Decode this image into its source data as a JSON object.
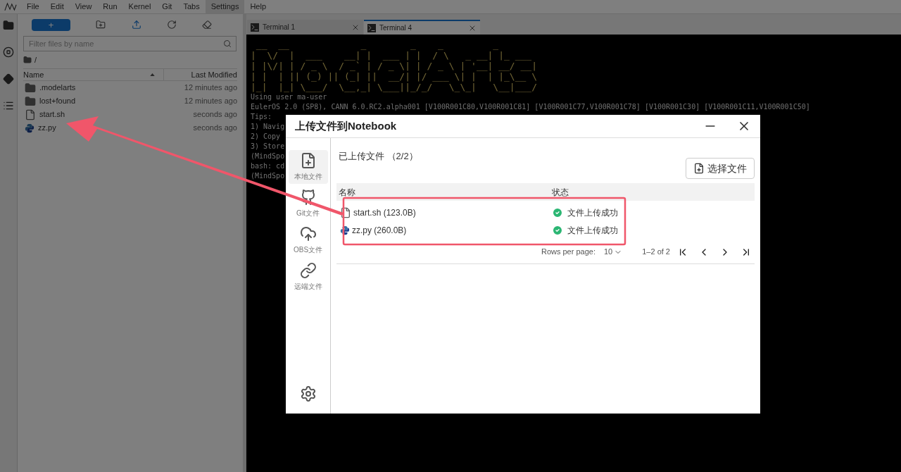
{
  "menu": [
    {
      "label": "File",
      "selected": false
    },
    {
      "label": "Edit",
      "selected": false
    },
    {
      "label": "View",
      "selected": false
    },
    {
      "label": "Run",
      "selected": false
    },
    {
      "label": "Kernel",
      "selected": false
    },
    {
      "label": "Git",
      "selected": false
    },
    {
      "label": "Tabs",
      "selected": false
    },
    {
      "label": "Settings",
      "selected": true
    },
    {
      "label": "Help",
      "selected": false
    }
  ],
  "toolbar": {
    "new_label": "+"
  },
  "file_browser": {
    "filter_placeholder": "Filter files by name",
    "path": "/",
    "columns": [
      "Name",
      "Last Modified"
    ],
    "rows": [
      {
        "name": ".modelarts",
        "modified": "12 minutes ago",
        "kind": "folder"
      },
      {
        "name": "lost+found",
        "modified": "12 minutes ago",
        "kind": "folder"
      },
      {
        "name": "start.sh",
        "modified": "seconds ago",
        "kind": "file"
      },
      {
        "name": "zz.py",
        "modified": "seconds ago",
        "kind": "python"
      }
    ]
  },
  "tabs": [
    {
      "label": "Terminal 1",
      "selected": false
    },
    {
      "label": "Terminal 4",
      "selected": true
    }
  ],
  "terminal": {
    "banner": [
      " __  __             _        _    _         _       ",
      "|  \\/  |  ___    __| |  ___ | |  / \\   _ __| |_ ___ ",
      "| |\\/| | / _ \\  / _` | / _ \\| | / _ \\ | '__| __/ __|",
      "| |  | || (_) || (_| ||  __/| |/ ___ \\| |  | |_\\__ \\",
      "|_|  |_| \\___/  \\__,_| \\___||_/_/   \\_\\_|   \\__|___/"
    ],
    "lines": [
      "Using user ma-user",
      "EulerOS 2.0 (SP8), CANN 6.0.RC2.alpha001 [V100R001C80,V100R001C81] [V100R001C77,V100R001C78] [V100R001C30] [V100R001C11,V100R001C50]",
      "Tips:",
      "1) Navig",
      "2) Copy",
      "3) Store",
      "(MindSpo",
      "bash: cd",
      "(MindSpo"
    ]
  },
  "dialog": {
    "title": "上传文件到Notebook",
    "nav": [
      {
        "label": "本地文件",
        "selected": true,
        "kind": "local"
      },
      {
        "label": "Git文件",
        "selected": false,
        "kind": "git"
      },
      {
        "label": "OBS文件",
        "selected": false,
        "kind": "obs"
      },
      {
        "label": "远端文件",
        "selected": false,
        "kind": "remote"
      }
    ],
    "heading": "已上传文件 （2/2）",
    "choose_button": "选择文件",
    "columns": [
      "名称",
      "状态"
    ],
    "rows": [
      {
        "name": "start.sh (123.0B)",
        "status": "文件上传成功",
        "kind": "file"
      },
      {
        "name": "zz.py (260.0B)",
        "status": "文件上传成功",
        "kind": "python"
      }
    ],
    "pagination": {
      "rows_label": "Rows per page:",
      "rows_value": "10",
      "range": "1–2 of 2"
    }
  }
}
